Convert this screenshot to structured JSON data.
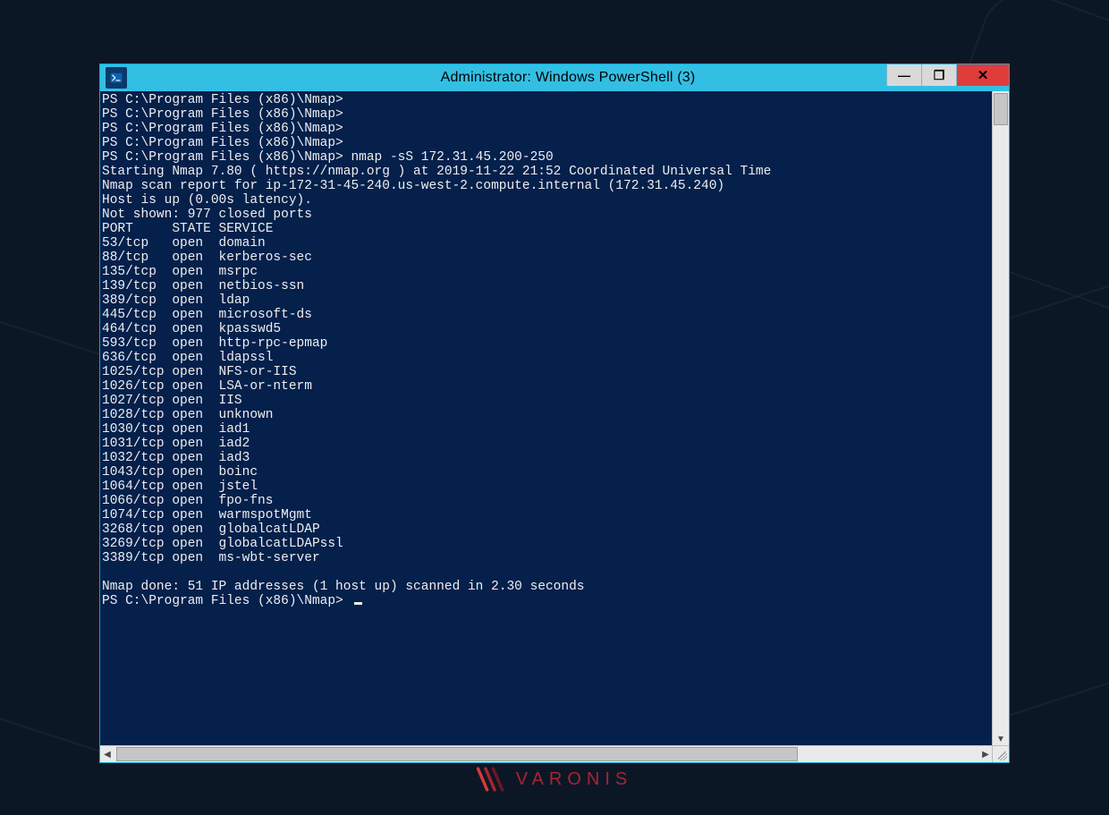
{
  "page": {
    "brand_text": "VARONIS"
  },
  "window": {
    "title": "Administrator: Windows PowerShell (3)",
    "buttons": {
      "minimize_glyph": "—",
      "maximize_glyph": "❐",
      "close_glyph": "✕"
    }
  },
  "terminal": {
    "prompt": "PS C:\\Program Files (x86)\\Nmap>",
    "command": "nmap -sS 172.31.45.200-250",
    "lines": [
      "PS C:\\Program Files (x86)\\Nmap>",
      "PS C:\\Program Files (x86)\\Nmap>",
      "PS C:\\Program Files (x86)\\Nmap>",
      "PS C:\\Program Files (x86)\\Nmap>",
      "PS C:\\Program Files (x86)\\Nmap> nmap -sS 172.31.45.200-250",
      "Starting Nmap 7.80 ( https://nmap.org ) at 2019-11-22 21:52 Coordinated Universal Time",
      "Nmap scan report for ip-172-31-45-240.us-west-2.compute.internal (172.31.45.240)",
      "Host is up (0.00s latency).",
      "Not shown: 977 closed ports",
      "PORT     STATE SERVICE",
      "53/tcp   open  domain",
      "88/tcp   open  kerberos-sec",
      "135/tcp  open  msrpc",
      "139/tcp  open  netbios-ssn",
      "389/tcp  open  ldap",
      "445/tcp  open  microsoft-ds",
      "464/tcp  open  kpasswd5",
      "593/tcp  open  http-rpc-epmap",
      "636/tcp  open  ldapssl",
      "1025/tcp open  NFS-or-IIS",
      "1026/tcp open  LSA-or-nterm",
      "1027/tcp open  IIS",
      "1028/tcp open  unknown",
      "1030/tcp open  iad1",
      "1031/tcp open  iad2",
      "1032/tcp open  iad3",
      "1043/tcp open  boinc",
      "1064/tcp open  jstel",
      "1066/tcp open  fpo-fns",
      "1074/tcp open  warmspotMgmt",
      "3268/tcp open  globalcatLDAP",
      "3269/tcp open  globalcatLDAPssl",
      "3389/tcp open  ms-wbt-server",
      "",
      "Nmap done: 51 IP addresses (1 host up) scanned in 2.30 seconds",
      "PS C:\\Program Files (x86)\\Nmap> "
    ]
  }
}
